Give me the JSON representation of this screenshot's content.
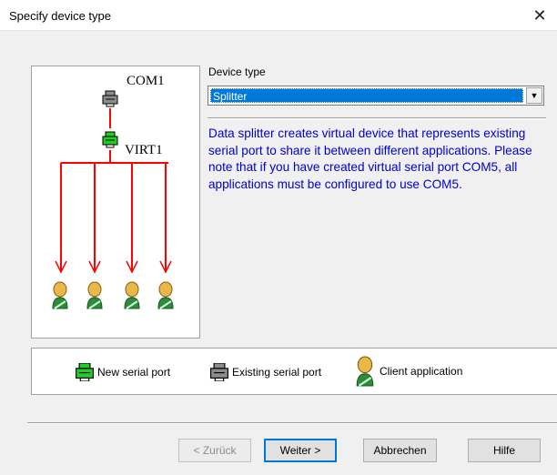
{
  "window": {
    "title": "Specify device type"
  },
  "diagram": {
    "com_label": "COM1",
    "virt_label": "VIRT1"
  },
  "device_type": {
    "label": "Device type",
    "selected": "Splitter"
  },
  "description": "Data splitter creates virtual device that represents existing serial port to share it between different applications. Please note that if you have created virtual serial port COM5, all applications must be configured to use COM5.",
  "legend": {
    "new_port": "New serial port",
    "existing_port": "Existing serial port",
    "client_app": "Client application"
  },
  "buttons": {
    "back": "< Zurück",
    "next": "Weiter >",
    "cancel": "Abbrechen",
    "help": "Hilfe"
  },
  "colors": {
    "new_port": "#22cc22",
    "existing_port": "#8c8c8c",
    "line": "#ff0000",
    "description_text": "#0000cc",
    "selection": "#0078d7"
  }
}
